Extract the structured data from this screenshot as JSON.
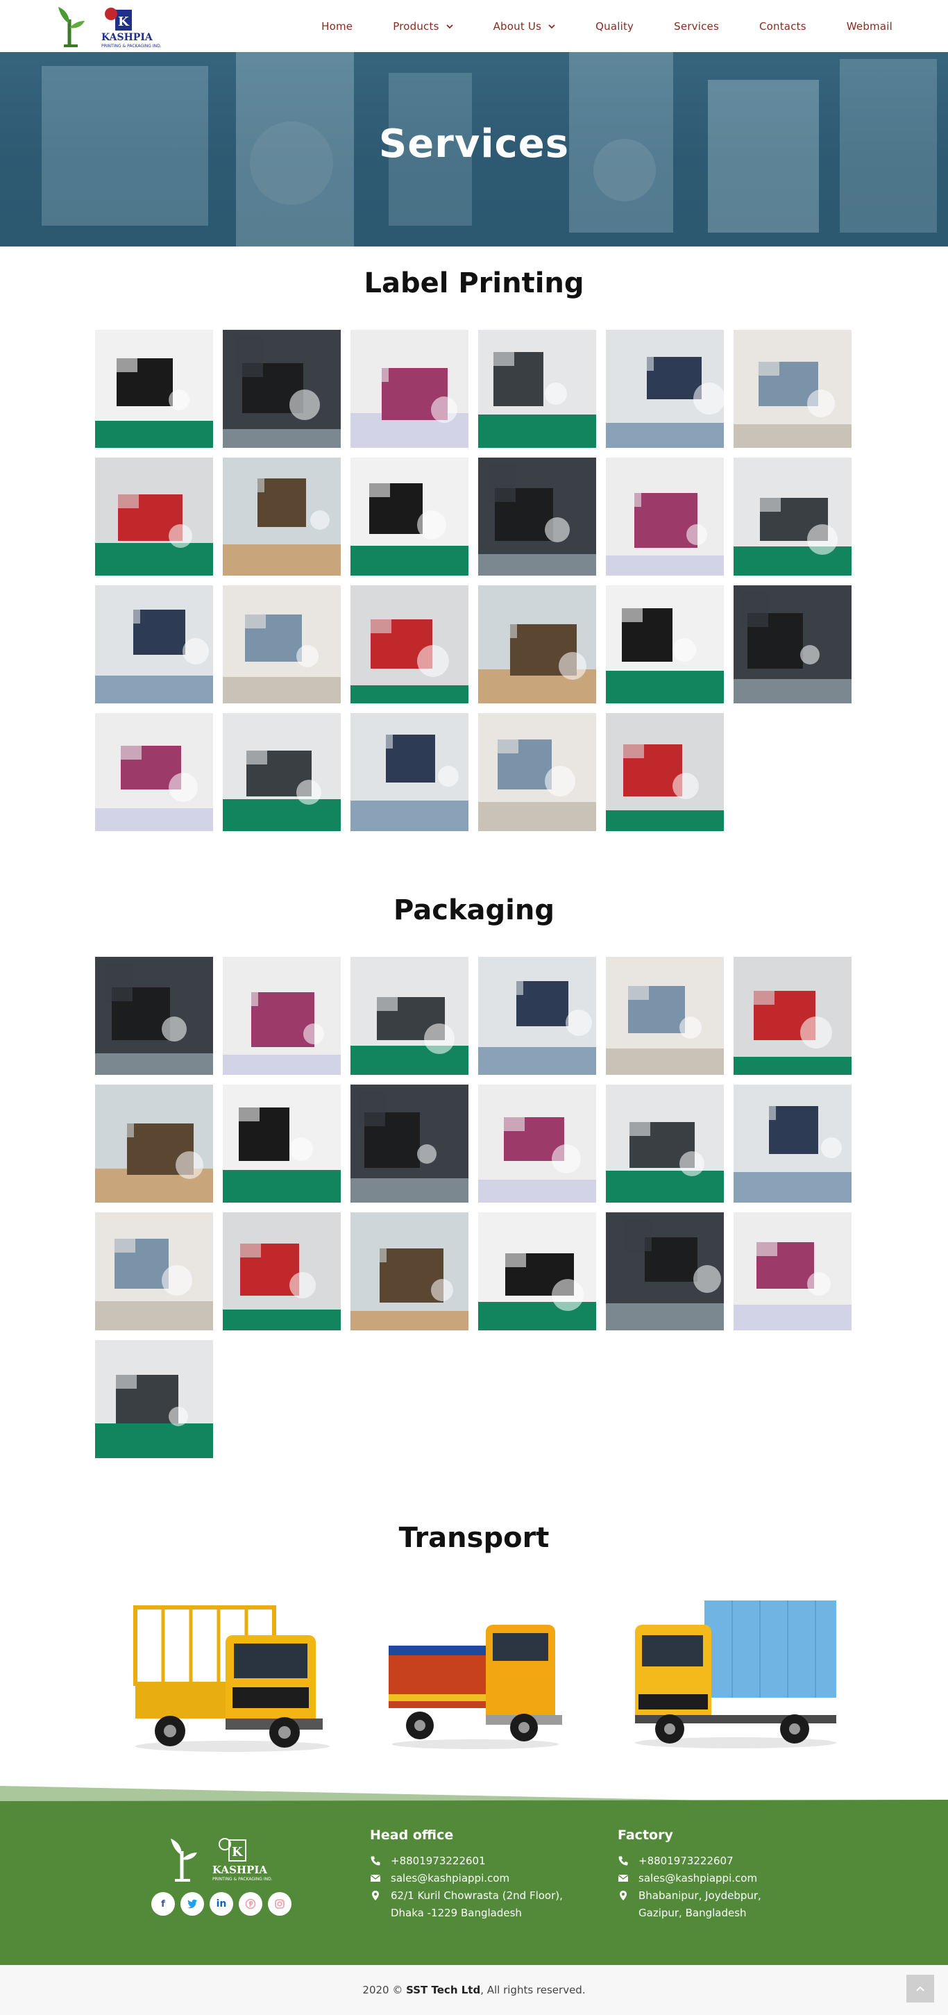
{
  "brand": {
    "logo_name": "KASHPIA",
    "logo_sub": "PRINTING & PACKAGING IND."
  },
  "nav": {
    "home": "Home",
    "products": "Products",
    "about": "About Us",
    "quality": "Quality",
    "services": "Services",
    "contacts": "Contacts",
    "webmail": "Webmail"
  },
  "hero": {
    "title": "Services"
  },
  "sections": {
    "label_printing": "Label Printing",
    "packaging": "Packaging",
    "transport": "Transport"
  },
  "gallery_counts": {
    "label_printing": 23,
    "packaging": 19,
    "transport": 3
  },
  "footer": {
    "head_office": {
      "title": "Head office",
      "phone": "+8801973222601",
      "email": "sales@kashpiappi.com",
      "address_line1": "62/1 Kuril Chowrasta (2nd Floor),",
      "address_line2": "Dhaka -1229 Bangladesh"
    },
    "factory": {
      "title": "Factory",
      "phone": "+8801973222607",
      "email": "sales@kashpiappi.com",
      "address_line1": "Bhabanipur, Joydebpur,",
      "address_line2": "Gazipur, Bangladesh"
    },
    "socials": [
      "facebook-icon",
      "twitter-icon",
      "linkedin-icon",
      "pinterest-icon",
      "instagram-icon"
    ]
  },
  "copyright": {
    "prefix": "2020 © ",
    "company": "SST Tech Ltd",
    "suffix": ", All rights reserved."
  },
  "colors": {
    "nav_text": "#8a2a1f",
    "hero": "#2f5c74",
    "footer": "#528a39",
    "factory_floor": "#12855f"
  }
}
